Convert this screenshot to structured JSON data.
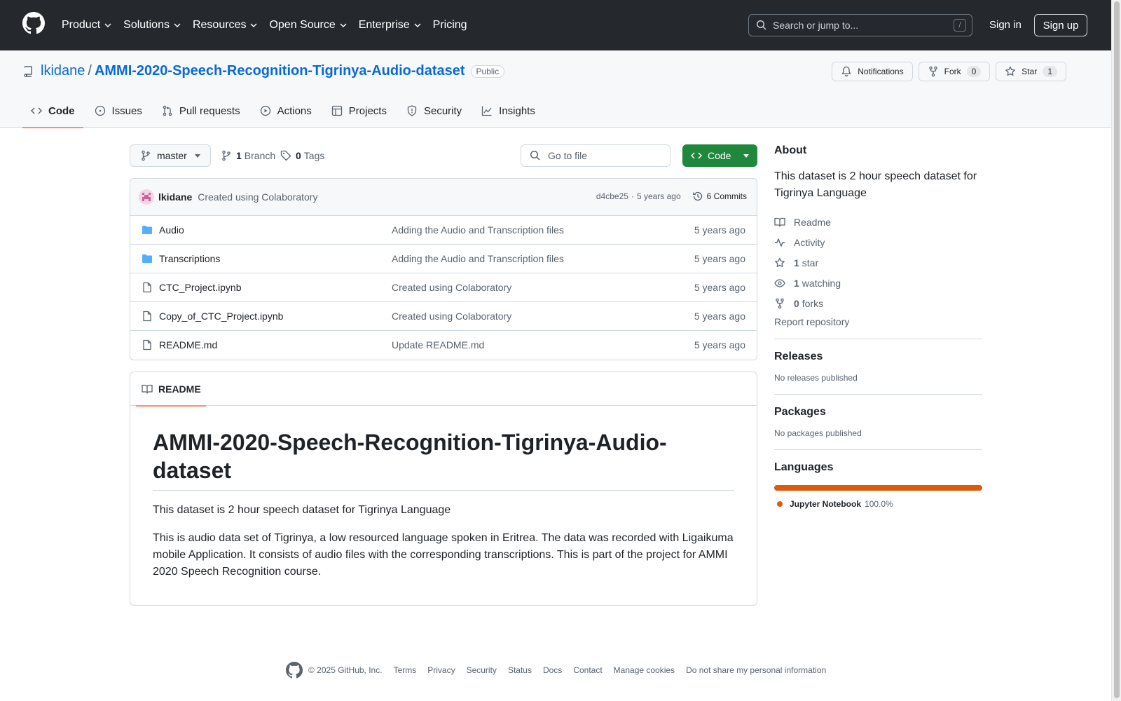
{
  "header": {
    "nav": [
      {
        "label": "Product",
        "has_menu": true
      },
      {
        "label": "Solutions",
        "has_menu": true
      },
      {
        "label": "Resources",
        "has_menu": true
      },
      {
        "label": "Open Source",
        "has_menu": true
      },
      {
        "label": "Enterprise",
        "has_menu": true
      },
      {
        "label": "Pricing",
        "has_menu": false
      }
    ],
    "search_placeholder": "Search or jump to...",
    "search_shortcut": "/",
    "signin": "Sign in",
    "signup": "Sign up"
  },
  "repo": {
    "owner": "lkidane",
    "separator": "/",
    "name": "AMMI-2020-Speech-Recognition-Tigrinya-Audio-dataset",
    "visibility": "Public",
    "notifications": "Notifications",
    "fork_label": "Fork",
    "fork_count": "0",
    "star_label": "Star",
    "star_count": "1",
    "tabs": [
      {
        "label": "Code",
        "icon": "code-icon",
        "active": true
      },
      {
        "label": "Issues",
        "icon": "issue-icon"
      },
      {
        "label": "Pull requests",
        "icon": "pull-request-icon"
      },
      {
        "label": "Actions",
        "icon": "play-icon"
      },
      {
        "label": "Projects",
        "icon": "table-icon"
      },
      {
        "label": "Security",
        "icon": "shield-icon"
      },
      {
        "label": "Insights",
        "icon": "graph-icon"
      }
    ]
  },
  "toolbar": {
    "branch": "master",
    "branch_count": "1",
    "branch_label": "Branch",
    "tag_count": "0",
    "tag_label": "Tags",
    "goto_placeholder": "Go to file",
    "code_button": "Code"
  },
  "commit": {
    "author": "lkidane",
    "message": "Created using Colaboratory",
    "sha": "d4cbe25",
    "dot": "·",
    "time": "5 years ago",
    "commits_label": "6 Commits"
  },
  "files": [
    {
      "type": "dir",
      "name": "Audio",
      "message": "Adding the Audio and Transcription files",
      "time": "5 years ago"
    },
    {
      "type": "dir",
      "name": "Transcriptions",
      "message": "Adding the Audio and Transcription files",
      "time": "5 years ago"
    },
    {
      "type": "file",
      "name": "CTC_Project.ipynb",
      "message": "Created using Colaboratory",
      "time": "5 years ago"
    },
    {
      "type": "file",
      "name": "Copy_of_CTC_Project.ipynb",
      "message": "Created using Colaboratory",
      "time": "5 years ago"
    },
    {
      "type": "file",
      "name": "README.md",
      "message": "Update README.md",
      "time": "5 years ago"
    }
  ],
  "readme": {
    "tab": "README",
    "title": "AMMI-2020-Speech-Recognition-Tigrinya-Audio-dataset",
    "p1": "This dataset is 2 hour speech dataset for Tigrinya Language",
    "p2": "This is audio data set of Tigrinya, a low resourced language spoken in Eritrea. The data was recorded with Ligaikuma mobile Application. It consists of audio files with the corresponding transcriptions. This is part of the project for AMMI 2020 Speech Recognition course."
  },
  "sidebar": {
    "about_title": "About",
    "about_desc": "This dataset is 2 hour speech dataset for Tigrinya Language",
    "links": {
      "readme": "Readme",
      "activity": "Activity",
      "stars_count": "1",
      "stars_label": "star",
      "watching_count": "1",
      "watching_label": "watching",
      "forks_count": "0",
      "forks_label": "forks"
    },
    "report": "Report repository",
    "releases_title": "Releases",
    "releases_sub": "No releases published",
    "packages_title": "Packages",
    "packages_sub": "No packages published",
    "languages_title": "Languages",
    "language": {
      "name": "Jupyter Notebook",
      "percent": "100.0%",
      "color": "#DA5B0B"
    }
  },
  "footer": {
    "copyright": "© 2025 GitHub, Inc.",
    "links": [
      "Terms",
      "Privacy",
      "Security",
      "Status",
      "Docs",
      "Contact",
      "Manage cookies",
      "Do not share my personal information"
    ]
  },
  "colors": {
    "header_bg": "#25292e",
    "link_blue": "#0969da",
    "code_green": "#1f883d",
    "tab_underline": "#fd8c73",
    "folder_blue": "#54aeff"
  }
}
